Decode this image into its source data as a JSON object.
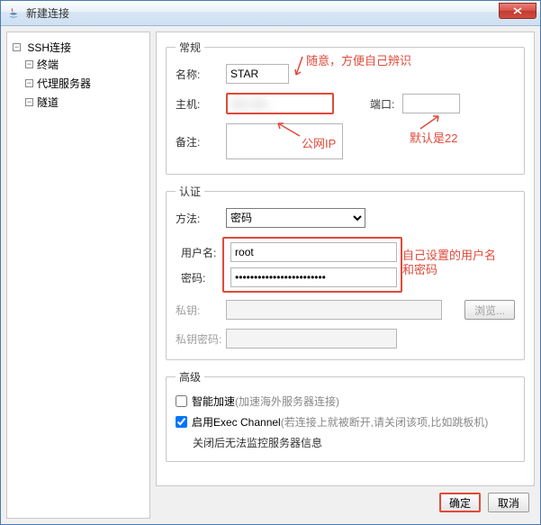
{
  "titlebar": {
    "title": "新建连接"
  },
  "tree": {
    "root": "SSH连接",
    "children": [
      "终端",
      "代理服务器",
      "隧道"
    ]
  },
  "general": {
    "legend": "常规",
    "name_label": "名称:",
    "name_value": "STAR",
    "host_label": "主机:",
    "host_value": "xxx xxx",
    "port_label": "端口:",
    "port_value": "",
    "remark_label": "备注:",
    "remark_value": ""
  },
  "auth": {
    "legend": "认证",
    "method_label": "方法:",
    "method_value": "密码",
    "user_label": "用户名:",
    "user_value": "root",
    "pass_label": "密码:",
    "pass_value": "************************",
    "key_label": "私钥:",
    "key_value": "",
    "browse_label": "浏览...",
    "keypass_label": "私钥密码:",
    "keypass_value": ""
  },
  "adv": {
    "legend": "高级",
    "accel_label": "智能加速 ",
    "accel_sub": "(加速海外服务器连接)",
    "exec_label": "启用Exec Channel",
    "exec_sub": "(若连接上就被断开,请关闭该项,比如跳板机)",
    "exec_note": "关闭后无法监控服务器信息"
  },
  "buttons": {
    "ok": "确定",
    "cancel": "取消"
  },
  "annotations": {
    "a1": "随意，方便自己辨识",
    "a2": "公网IP",
    "a3": "默认是22",
    "a4": "自己设置的用户名",
    "a5": "和密码"
  }
}
